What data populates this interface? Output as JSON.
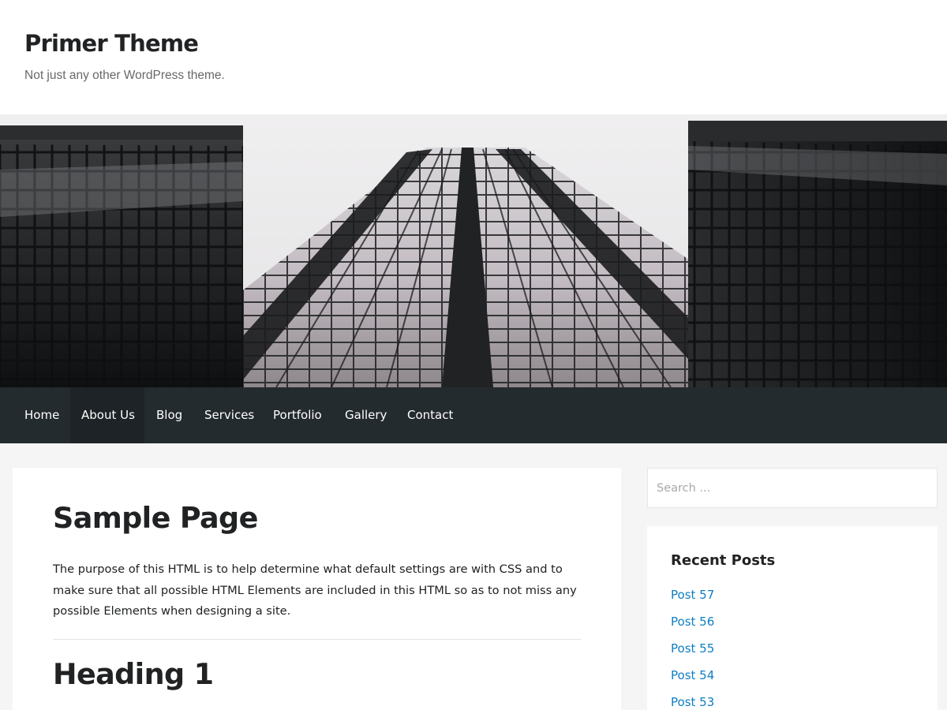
{
  "site": {
    "title": "Primer Theme",
    "tagline": "Not just any other WordPress theme."
  },
  "hero": {
    "alt": "Looking up at glass skyscrapers"
  },
  "nav": {
    "items": [
      {
        "label": "Home"
      },
      {
        "label": "About Us",
        "current": true
      },
      {
        "label": "Blog"
      },
      {
        "label": "Services"
      },
      {
        "label": "Portfolio"
      },
      {
        "label": "Gallery"
      },
      {
        "label": "Contact"
      }
    ]
  },
  "content": {
    "page_title": "Sample Page",
    "intro": "The purpose of this HTML is to help determine what default settings are with CSS and to make sure that all possible HTML Elements are included in this HTML so as to not miss any possible Elements when designing a site.",
    "heading_1": "Heading 1"
  },
  "sidebar": {
    "search_placeholder": "Search ...",
    "recent_posts": {
      "title": "Recent Posts",
      "items": [
        "Post 57",
        "Post 56",
        "Post 55",
        "Post 54",
        "Post 53"
      ]
    }
  },
  "colors": {
    "nav_background": "#242b2f",
    "nav_current": "#1d2326",
    "link": "#0f7dc2",
    "page_background": "#f5f5f5"
  }
}
